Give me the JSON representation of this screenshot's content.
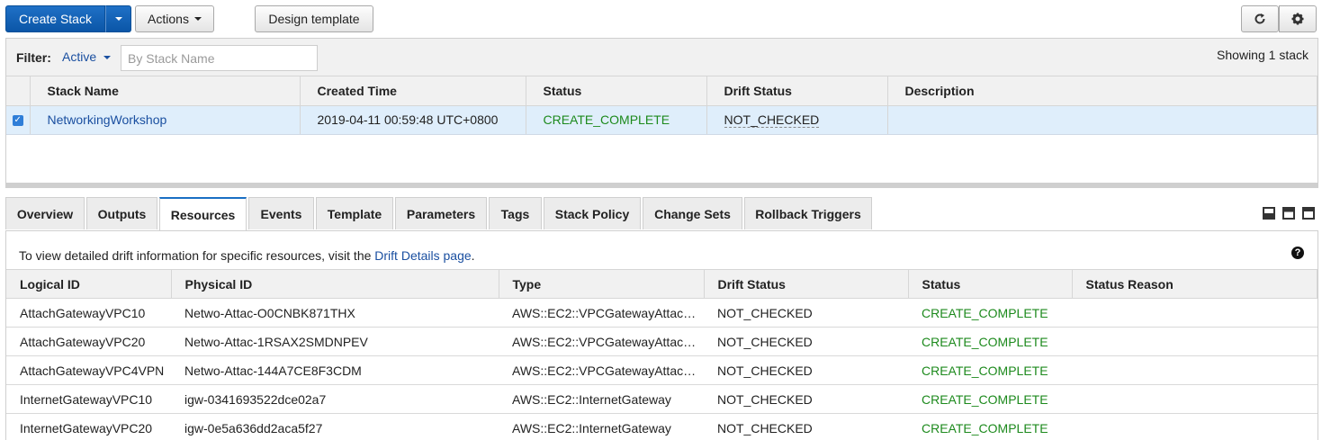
{
  "toolbar": {
    "create_stack": "Create Stack",
    "actions": "Actions",
    "design_template": "Design template"
  },
  "filter": {
    "label": "Filter:",
    "active": "Active",
    "placeholder": "By Stack Name",
    "showing": "Showing 1 stack"
  },
  "stack_table": {
    "columns": [
      "Stack Name",
      "Created Time",
      "Status",
      "Drift Status",
      "Description"
    ],
    "rows": [
      {
        "checked": true,
        "stack_name": "NetworkingWorkshop",
        "created_time": "2019-04-11 00:59:48 UTC+0800",
        "status": "CREATE_COMPLETE",
        "drift_status": "NOT_CHECKED",
        "description": ""
      }
    ]
  },
  "tabs": [
    "Overview",
    "Outputs",
    "Resources",
    "Events",
    "Template",
    "Parameters",
    "Tags",
    "Stack Policy",
    "Change Sets",
    "Rollback Triggers"
  ],
  "active_tab": "Resources",
  "resources": {
    "note_prefix": "To view detailed drift information for specific resources, visit the ",
    "note_link": "Drift Details page",
    "note_suffix": ".",
    "columns": [
      "Logical ID",
      "Physical ID",
      "Type",
      "Drift Status",
      "Status",
      "Status Reason"
    ],
    "rows": [
      [
        "AttachGatewayVPC10",
        "Netwo-Attac-O0CNBK871THX",
        "AWS::EC2::VPCGatewayAttac…",
        "NOT_CHECKED",
        "CREATE_COMPLETE",
        ""
      ],
      [
        "AttachGatewayVPC20",
        "Netwo-Attac-1RSAX2SMDNPEV",
        "AWS::EC2::VPCGatewayAttac…",
        "NOT_CHECKED",
        "CREATE_COMPLETE",
        ""
      ],
      [
        "AttachGatewayVPC4VPN",
        "Netwo-Attac-144A7CE8F3CDM",
        "AWS::EC2::VPCGatewayAttac…",
        "NOT_CHECKED",
        "CREATE_COMPLETE",
        ""
      ],
      [
        "InternetGatewayVPC10",
        "igw-0341693522dce02a7",
        "AWS::EC2::InternetGateway",
        "NOT_CHECKED",
        "CREATE_COMPLETE",
        ""
      ],
      [
        "InternetGatewayVPC20",
        "igw-0e5a636dd2aca5f27",
        "AWS::EC2::InternetGateway",
        "NOT_CHECKED",
        "CREATE_COMPLETE",
        ""
      ]
    ]
  },
  "colors": {
    "primary": "#0b56a7",
    "link": "#1a4fa0",
    "success": "#1d8a1d",
    "selected_row": "#dfeefb"
  },
  "icons": {
    "refresh": "refresh-icon",
    "settings": "gear-icon",
    "help": "help-icon"
  }
}
